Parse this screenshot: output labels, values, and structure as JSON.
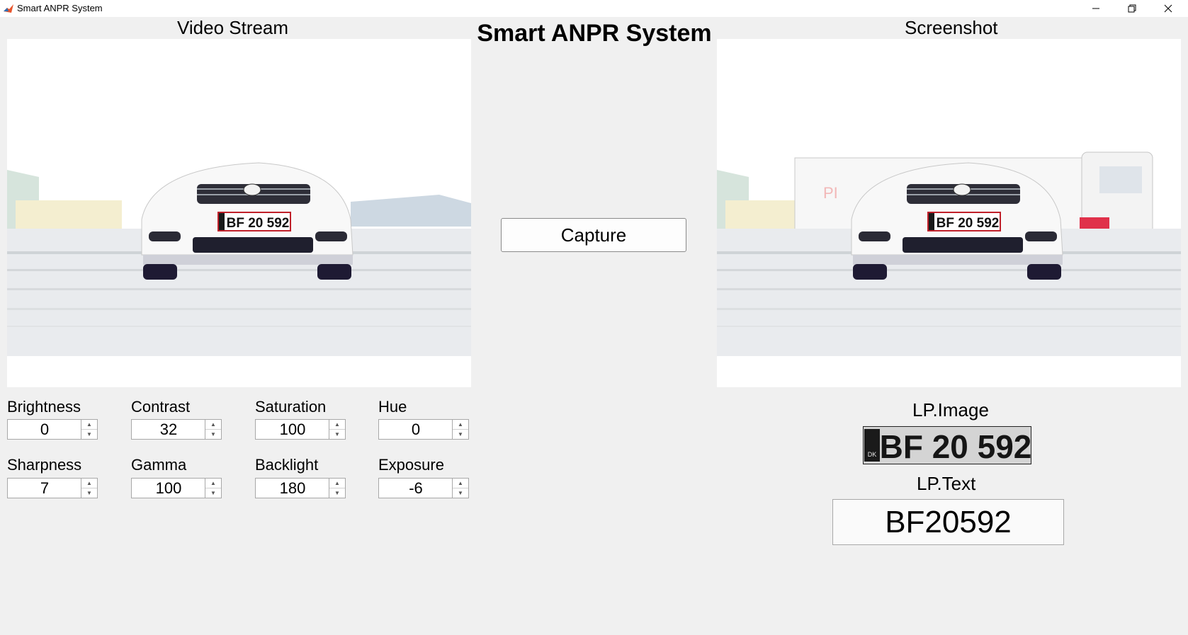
{
  "window": {
    "title": "Smart ANPR System",
    "icons": [
      "matlab-icon",
      "minimize-icon",
      "restore-icon",
      "close-icon"
    ]
  },
  "app_title": "Smart ANPR System",
  "video_panel": {
    "title": "Video Stream",
    "plate": "BF 20 592"
  },
  "screenshot_panel": {
    "title": "Screenshot",
    "plate": "BF 20 592"
  },
  "capture_label": "Capture",
  "controls": [
    {
      "label": "Brightness",
      "value": "0"
    },
    {
      "label": "Contrast",
      "value": "32"
    },
    {
      "label": "Saturation",
      "value": "100"
    },
    {
      "label": "Hue",
      "value": "0"
    },
    {
      "label": "Sharpness",
      "value": "7"
    },
    {
      "label": "Gamma",
      "value": "100"
    },
    {
      "label": "Backlight",
      "value": "180"
    },
    {
      "label": "Exposure",
      "value": "-6"
    }
  ],
  "lp_image": {
    "label": "LP.Image",
    "country": "DK",
    "plate": "BF 20 592"
  },
  "lp_text": {
    "label": "LP.Text",
    "value": "BF20592"
  },
  "colors": {
    "background": "#f0f0f0",
    "plate_border": "#c0202a",
    "eu_band": "#1a1a1a"
  }
}
